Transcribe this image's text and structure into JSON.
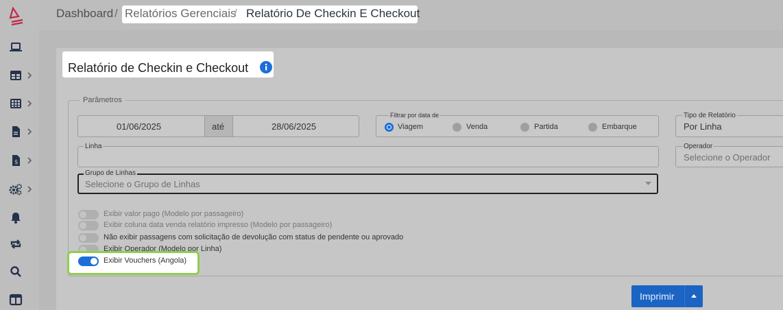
{
  "colors": {
    "accent": "#1d6ed8",
    "highlight": "#8fcf4f",
    "logo": "#c0284a"
  },
  "breadcrumb": {
    "dashboard": "Dashboard",
    "sep": "/",
    "reports": "Relatórios Gerenciais",
    "current": "Relatório De Checkin E Checkout"
  },
  "sidebar": {
    "items": [
      {
        "icon": "laptop-icon"
      },
      {
        "icon": "table-icon"
      },
      {
        "icon": "grid-icon"
      },
      {
        "icon": "document-icon"
      },
      {
        "icon": "money-document-icon"
      },
      {
        "icon": "gears-icon"
      },
      {
        "icon": "bell-icon"
      },
      {
        "icon": "sync-icon"
      },
      {
        "icon": "search-icon"
      },
      {
        "icon": "columns-icon"
      }
    ]
  },
  "page": {
    "title": "Relatório de Checkin e Checkout"
  },
  "params": {
    "legend": "Parâmetros",
    "date_from": "01/06/2025",
    "date_sep": "até",
    "date_to": "28/06/2025",
    "filter_label": "Filtrar por data de",
    "filter_options": [
      "Viagem",
      "Venda",
      "Partida",
      "Embarque"
    ],
    "filter_selected": "Viagem",
    "report_type_label": "Tipo de Relatório",
    "report_type_value": "Por Linha",
    "line_label": "Linha",
    "operator_label": "Operador",
    "operator_placeholder": "Selecione o Operador",
    "group_label": "Grupo de Linhas",
    "group_placeholder": "Selecione o Grupo de Linhas"
  },
  "toggles": [
    {
      "label": "Exibir valor pago (Modelo por passageiro)",
      "on": false
    },
    {
      "label": "Exibir coluna data venda relatório impresso (Modelo por passageiro)",
      "on": false
    },
    {
      "label": "Não exibir passagens com solicitação de devolução com status de pendente ou aprovado",
      "on": false
    },
    {
      "label": "Exibir Operador (Modelo por Linha)",
      "on": false
    },
    {
      "label": "Exibir Vouchers (Angola)",
      "on": true
    }
  ],
  "print_button": {
    "label": "Imprimir"
  }
}
